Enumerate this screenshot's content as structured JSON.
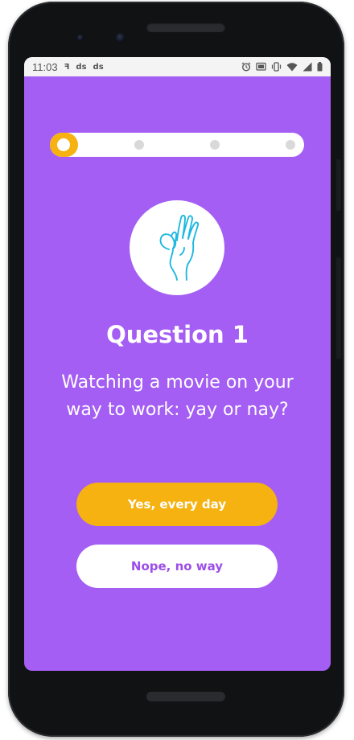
{
  "status_bar": {
    "time": "11:03",
    "left_icons": [
      "notification-icon",
      "ds-icon",
      "ds-icon"
    ],
    "right_icons": [
      "alarm-icon",
      "cast-icon",
      "vibrate-icon",
      "wifi-icon",
      "signal-icon",
      "battery-icon"
    ],
    "left_icon_labels": [
      "ꟻ",
      "ds",
      "ds"
    ]
  },
  "quiz": {
    "progress": {
      "current_step": 1,
      "total_steps": 4,
      "fill_color": "#f5b210"
    },
    "illustration_icon": "ok-hand-icon",
    "title": "Question 1",
    "question": "Watching a movie on your way to work: yay or nay?",
    "answers": [
      {
        "label": "Yes, every day",
        "style": "primary"
      },
      {
        "label": "Nope, no way",
        "style": "secondary"
      }
    ]
  },
  "colors": {
    "background": "#a45ef3",
    "accent": "#f5b210",
    "secondary_text": "#9c4ee8",
    "icon_stroke": "#1fb8e0"
  }
}
